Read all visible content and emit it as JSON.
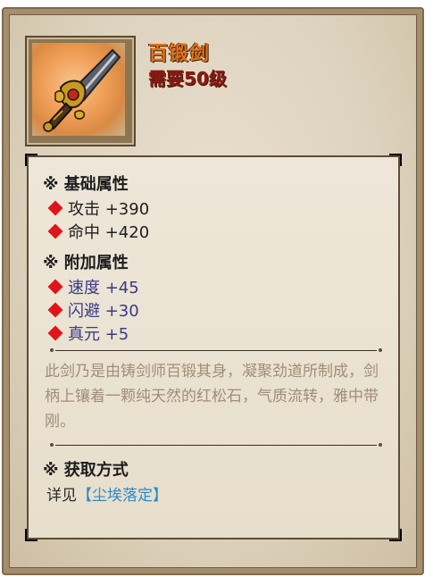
{
  "item": {
    "name": "百锻剑",
    "level_req": "需要50级"
  },
  "sections": {
    "basic_title": "※ 基础属性",
    "basic_attrs": [
      "攻击 +390",
      "命中 +420"
    ],
    "extra_title": "※ 附加属性",
    "extra_attrs": [
      "速度 +45",
      "闪避 +30",
      "真元 +5"
    ],
    "description": "此剑乃是由铸剑师百锻其身，凝聚劲道所制成，剑柄上镶着一颗纯天然的红松石，气质流转，雅中带刚。",
    "source_title": "※ 获取方式",
    "source_prefix": "详见",
    "source_link": "【尘埃落定】"
  },
  "colors": {
    "title": "#e27217",
    "level": "#8a1a12",
    "diamond": "#e0141a",
    "link": "#2a8cc9"
  },
  "icons": {
    "item": "sword-icon",
    "bullet": "red-diamond-icon"
  }
}
